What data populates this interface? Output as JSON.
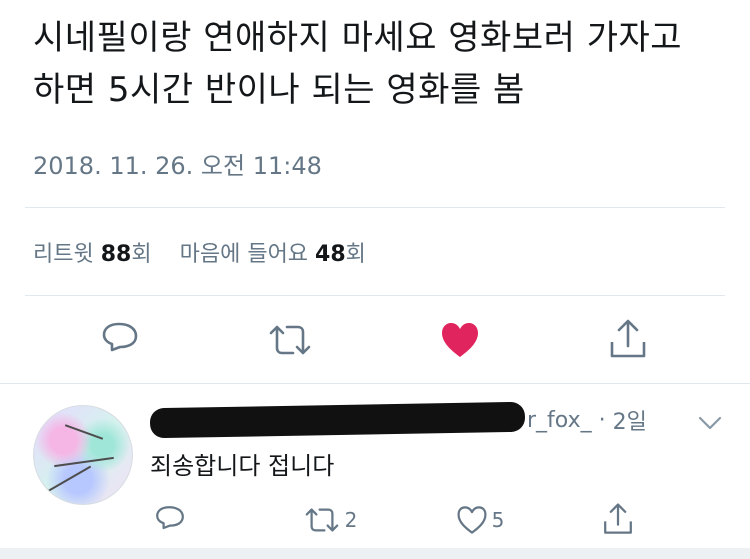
{
  "tweet": {
    "text": "시네필이랑 연애하지 마세요 영화보러 가자고 하면 5시간 반이나 되는 영화를 봄",
    "timestamp": "2018. 11. 26. 오전 11:48",
    "stats": {
      "retweet_label": "리트윗",
      "retweet_count": "88",
      "retweet_unit": "회",
      "like_label": "마음에 들어요",
      "like_count": "48",
      "like_unit": "회"
    },
    "actions": {
      "reply_icon": "reply-icon",
      "retweet_icon": "retweet-icon",
      "like_icon": "heart-filled-icon",
      "share_icon": "share-icon",
      "like_color": "#e0245e",
      "icon_color": "#657786"
    }
  },
  "reply": {
    "username_visible": "r_fox_",
    "separator": "·",
    "time": "2일",
    "text": "죄송합니다 접니다",
    "retweet_count": "2",
    "like_count": "5",
    "more_icon": "chevron-down-icon"
  }
}
